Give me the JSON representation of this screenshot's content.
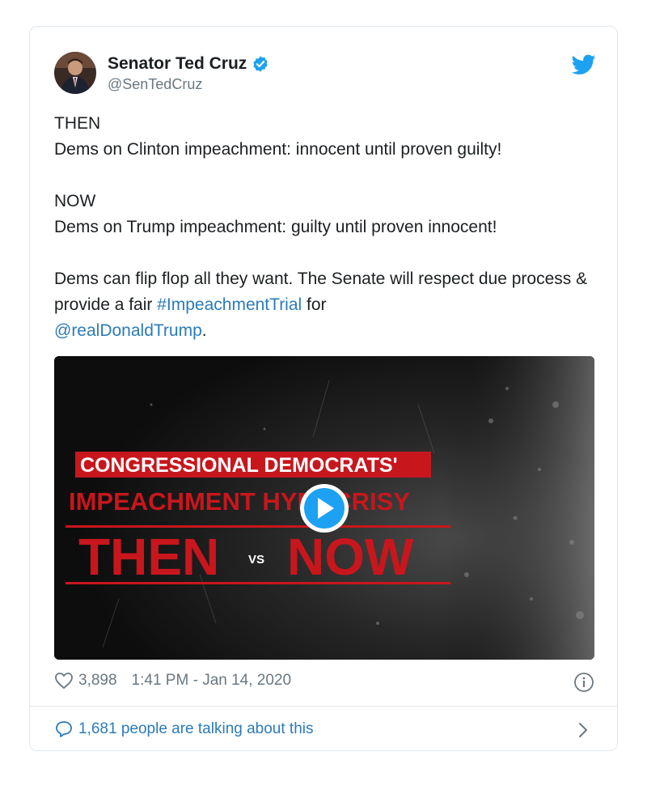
{
  "tweet": {
    "author_name": "Senator Ted Cruz",
    "handle": "@SenTedCruz",
    "line1": "THEN",
    "line2": "Dems on Clinton impeachment: innocent until proven guilty!",
    "line3": "NOW",
    "line4": "Dems on Trump impeachment: guilty until proven innocent!",
    "line5_a": "Dems can flip flop all they want. The Senate will respect due process & provide a fair ",
    "hashtag": "#ImpeachmentTrial",
    "line5_b": " for",
    "mention": "@realDonaldTrump",
    "line5_end": "."
  },
  "video": {
    "line1": "CONGRESSIONAL DEMOCRATS'",
    "line2": "IMPEACHMENT HYPOCRISY",
    "then": "THEN",
    "vs": "VS",
    "now": "NOW"
  },
  "footer": {
    "likes": "3,898",
    "timestamp": "1:41 PM - Jan 14, 2020",
    "talking": "1,681 people are talking about this"
  },
  "colors": {
    "link": "#2b7bb9",
    "twitter_blue": "#1da1f2",
    "video_red": "#c8161d"
  },
  "icons": [
    "verified-badge-icon",
    "twitter-bird-icon",
    "play-icon",
    "heart-icon",
    "info-icon",
    "speech-bubble-icon",
    "chevron-right-icon"
  ]
}
